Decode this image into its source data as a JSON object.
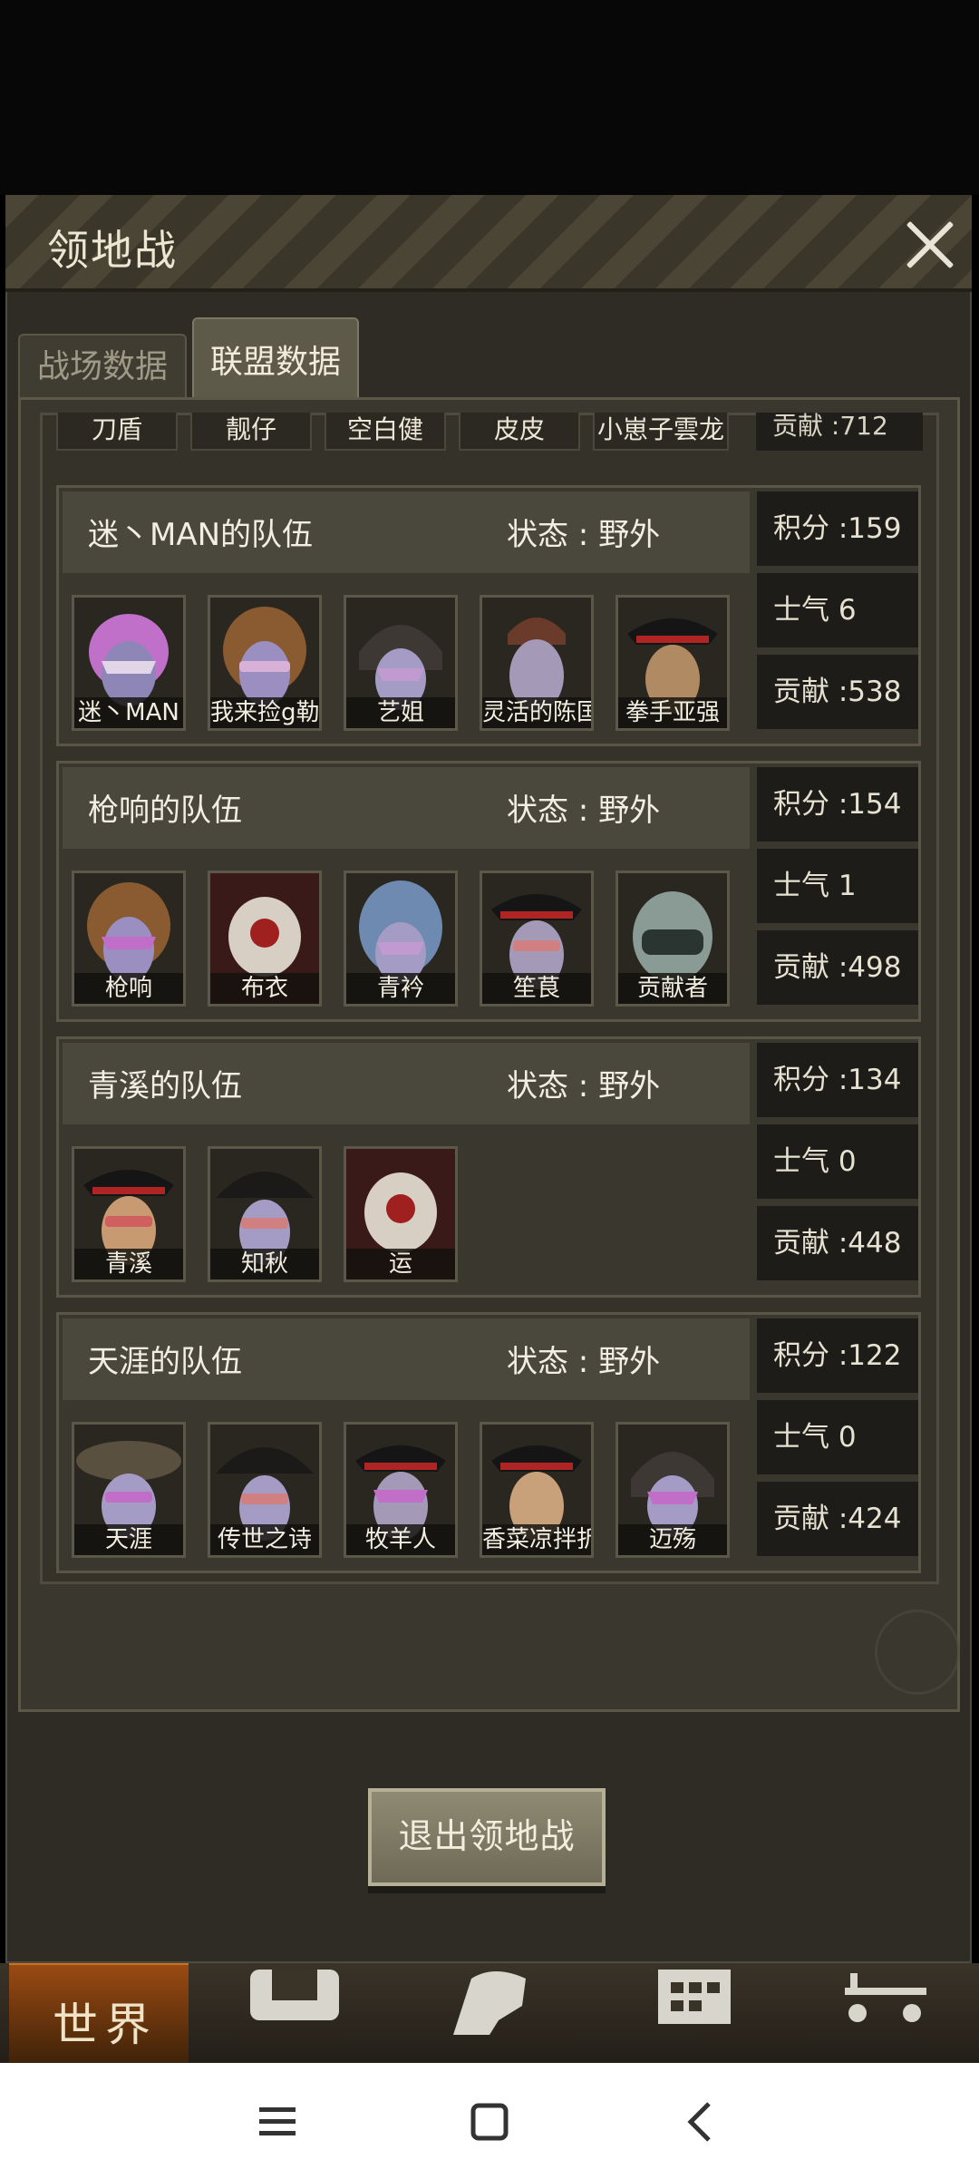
{
  "dialog": {
    "title": "领地战",
    "tabs": [
      {
        "label": "战场数据",
        "active": false
      },
      {
        "label": "联盟数据",
        "active": true
      }
    ],
    "clipped_team": {
      "members": [
        "刀盾",
        "靓仔",
        "空白健",
        "皮皮",
        "小崽子雲龙"
      ],
      "contribution": "贡献 :712"
    },
    "teams": [
      {
        "name": "迷丶MAN的队伍",
        "status": "状态 : 野外",
        "score": "积分 :159",
        "morale": "士气 6",
        "contribution": "贡献 :538",
        "members": [
          "迷丶MAN",
          "我来捡g勒",
          "艺姐",
          "灵活的陈国",
          "拳手亚强"
        ]
      },
      {
        "name": "枪响的队伍",
        "status": "状态 : 野外",
        "score": "积分 :154",
        "morale": "士气 1",
        "contribution": "贡献 :498",
        "members": [
          "枪响",
          "布衣",
          "青衿",
          "笙茛",
          "贡献者"
        ]
      },
      {
        "name": "青溪的队伍",
        "status": "状态 : 野外",
        "score": "积分 :134",
        "morale": "士气 0",
        "contribution": "贡献 :448",
        "members": [
          "青溪",
          "知秋",
          "运"
        ]
      },
      {
        "name": "天涯的队伍",
        "status": "状态 : 野外",
        "score": "积分 :122",
        "morale": "士气 0",
        "contribution": "贡献 :424",
        "members": [
          "天涯",
          "传世之诗",
          "牧羊人",
          "香菜凉拌折",
          "迈殇"
        ]
      }
    ],
    "exit_button": "退出领地战"
  },
  "bottom_nav": {
    "world_label": "世界",
    "icons": [
      "backpack-icon",
      "profile-head-icon",
      "building-icon",
      "cart-icon"
    ]
  },
  "colors": {
    "panel": "#3a372e",
    "stat_box": "#1d1c19",
    "accent_world": "#9a4a12"
  }
}
